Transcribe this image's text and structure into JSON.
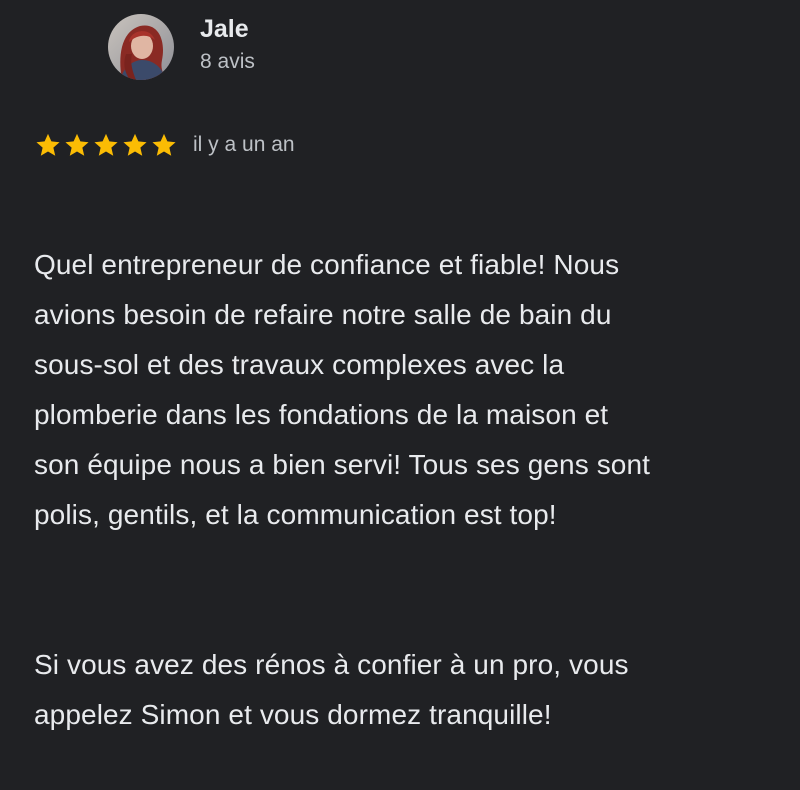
{
  "review": {
    "author_name": "Jale",
    "author_meta": "8 avis",
    "rating": 5,
    "rating_max": 5,
    "time_ago": "il y a un an",
    "paragraphs": [
      "Quel entrepreneur de confiance et fiable! Nous\navions besoin de refaire notre salle de bain du\nsous-sol et des travaux complexes avec la\nplomberie dans les fondations de la maison et\nson équipe nous a bien servi! Tous ses gens sont\npolis, gentils, et la communication est top!",
      "Si vous avez des rénos à confier à un pro, vous\nappelez Simon et vous dormez tranquille!"
    ]
  },
  "colors": {
    "background": "#202124",
    "text_primary": "#e8eaed",
    "text_secondary": "#bdc1c6",
    "star": "#fbbc04"
  },
  "icons": {
    "star": "star-icon",
    "avatar": "user-avatar-photo"
  }
}
